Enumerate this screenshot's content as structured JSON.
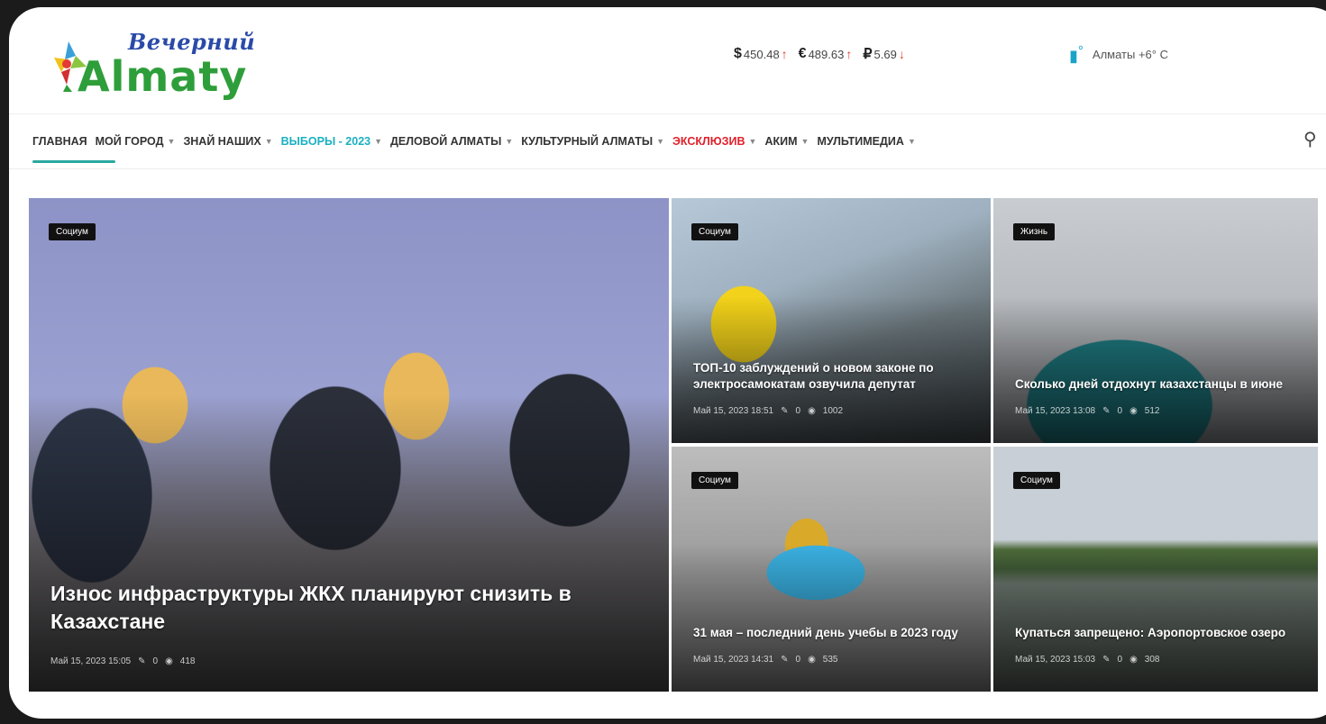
{
  "header": {
    "logo_script": "Вечерний",
    "logo_main": "Almaty",
    "rates": [
      {
        "symbol": "$",
        "value": "450.48",
        "dir": "up"
      },
      {
        "symbol": "€",
        "value": "489.63",
        "dir": "up"
      },
      {
        "symbol": "₽",
        "value": "5.69",
        "dir": "down"
      }
    ],
    "weather": {
      "icon": "thermometer-icon",
      "temp_symbol": "°",
      "text": "Алматы +6° С"
    }
  },
  "nav": {
    "items": [
      {
        "label": "ГЛАВНАЯ",
        "dropdown": false,
        "style": "active"
      },
      {
        "label": "МОЙ ГОРОД",
        "dropdown": true,
        "style": ""
      },
      {
        "label": "ЗНАЙ НАШИХ",
        "dropdown": true,
        "style": ""
      },
      {
        "label": "ВЫБОРЫ - 2023",
        "dropdown": true,
        "style": "teal"
      },
      {
        "label": "ДЕЛОВОЙ АЛМАТЫ",
        "dropdown": true,
        "style": ""
      },
      {
        "label": "КУЛЬТУРНЫЙ АЛМАТЫ",
        "dropdown": true,
        "style": ""
      },
      {
        "label": "ЭКСКЛЮЗИВ",
        "dropdown": true,
        "style": "red"
      },
      {
        "label": "АКИМ",
        "dropdown": true,
        "style": ""
      },
      {
        "label": "МУЛЬТИМЕДИА",
        "dropdown": true,
        "style": ""
      }
    ],
    "search_icon": "search-icon"
  },
  "tiles": [
    {
      "category": "Социум",
      "title": "Износ инфраструктуры ЖКХ планируют снизить в Казахстане",
      "date": "Май 15, 2023 15:05",
      "comments": "0",
      "views": "418"
    },
    {
      "category": "Социум",
      "title": "ТОП-10 заблуждений о новом законе по электросамокатам озвучила депутат",
      "date": "Май 15, 2023 18:51",
      "comments": "0",
      "views": "1002"
    },
    {
      "category": "Жизнь",
      "title": "Сколько дней отдохнут казахстанцы в июне",
      "date": "Май 15, 2023 13:08",
      "comments": "0",
      "views": "512"
    },
    {
      "category": "Социум",
      "title": "31 мая – последний день учебы в 2023 году",
      "date": "Май 15, 2023 14:31",
      "comments": "0",
      "views": "535"
    },
    {
      "category": "Социум",
      "title": "Купаться запрещено: Аэропортовское озеро",
      "date": "Май 15, 2023 15:03",
      "comments": "0",
      "views": "308"
    }
  ]
}
